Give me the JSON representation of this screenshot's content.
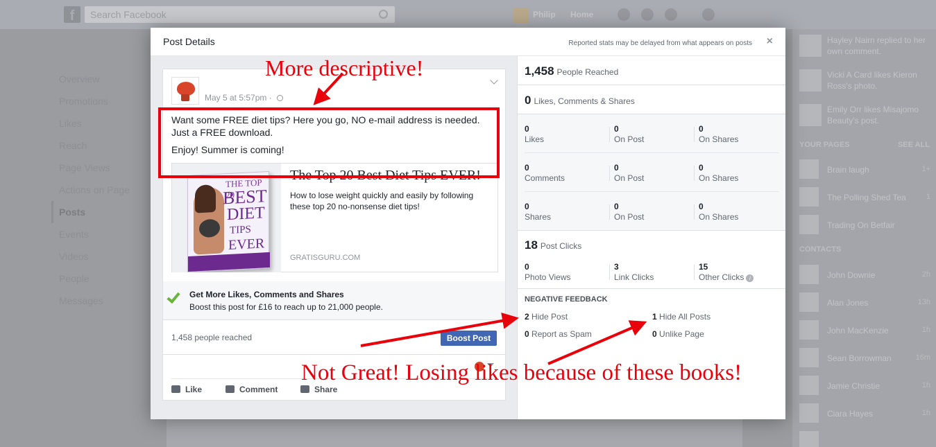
{
  "background": {
    "search_placeholder": "Search Facebook",
    "user_name": "Philip",
    "home_label": "Home",
    "nav_items": [
      "Overview",
      "Promotions",
      "Likes",
      "Reach",
      "Page Views",
      "Actions on Page",
      "Posts",
      "Events",
      "Videos",
      "People",
      "Messages"
    ],
    "active_nav": "Posts",
    "notifications": [
      "Hayley Nairn replied to her own comment.",
      "Vicki A Card likes Kieron Ross's photo.",
      "Emily Orr likes Misajomo Beauty's post."
    ],
    "your_pages_label": "YOUR PAGES",
    "see_all_label": "SEE ALL",
    "pages": [
      {
        "name": "Brain laugh",
        "count": "1+"
      },
      {
        "name": "The Polling Shed Tea",
        "count": "1"
      },
      {
        "name": "Trading On Betfair",
        "count": ""
      }
    ],
    "contacts_label": "CONTACTS",
    "contacts": [
      {
        "name": "John Downie",
        "time": "2h"
      },
      {
        "name": "Alan Jones",
        "time": "13h"
      },
      {
        "name": "John MacKenzie",
        "time": "1h"
      },
      {
        "name": "Sean Borrowman",
        "time": "16m"
      },
      {
        "name": "Jamie Christie",
        "time": "1h"
      },
      {
        "name": "Ciara Hayes",
        "time": "1h"
      },
      {
        "name": "",
        "time": ""
      }
    ]
  },
  "modal": {
    "title": "Post Details",
    "note": "Reported stats may be delayed from what appears on posts",
    "close_label": "×"
  },
  "post": {
    "timestamp": "May 5 at 5:57pm",
    "text_line1": "Want some FREE diet tips? Here you go, NO e-mail address is needed. Just a FREE download.",
    "text_line2": "Enjoy! Summer is coming!",
    "link": {
      "title": "The Top 20 Best Diet Tips EVER!",
      "description": "How to lose weight quickly and easily by following these top 20 no-nonsense diet tips!",
      "domain": "GRATISGURU.COM",
      "book_lines": [
        "THE TOP 20",
        "BEST",
        "DIET",
        "TIPS",
        "EVER"
      ]
    },
    "boost_title": "Get More Likes, Comments and Shares",
    "boost_sub": "Boost this post for £16 to reach up to 21,000 people.",
    "reached": "1,458 people reached",
    "boost_button": "Boost Post",
    "actions": {
      "like": "Like",
      "comment": "Comment",
      "share": "Share"
    }
  },
  "stats": {
    "people_reached": {
      "value": "1,458",
      "label": "People Reached"
    },
    "engagement": {
      "value": "0",
      "label": "Likes, Comments & Shares"
    },
    "grid": [
      [
        {
          "n": "0",
          "l": "Likes"
        },
        {
          "n": "0",
          "l": "On Post"
        },
        {
          "n": "0",
          "l": "On Shares"
        }
      ],
      [
        {
          "n": "0",
          "l": "Comments"
        },
        {
          "n": "0",
          "l": "On Post"
        },
        {
          "n": "0",
          "l": "On Shares"
        }
      ],
      [
        {
          "n": "0",
          "l": "Shares"
        },
        {
          "n": "0",
          "l": "On Post"
        },
        {
          "n": "0",
          "l": "On Shares"
        }
      ]
    ],
    "post_clicks": {
      "value": "18",
      "label": "Post Clicks"
    },
    "clicks": [
      {
        "n": "0",
        "l": "Photo Views"
      },
      {
        "n": "3",
        "l": "Link Clicks"
      },
      {
        "n": "15",
        "l": "Other Clicks"
      }
    ],
    "negative_feedback_label": "NEGATIVE FEEDBACK",
    "negative": {
      "hide_post": {
        "n": "2",
        "l": "Hide Post"
      },
      "hide_all": {
        "n": "1",
        "l": "Hide All Posts"
      },
      "spam": {
        "n": "0",
        "l": "Report as Spam"
      },
      "unlike": {
        "n": "0",
        "l": "Unlike Page"
      }
    }
  },
  "annotations": {
    "top": "More descriptive!",
    "bottom": "Not Great! Losing likes because of these books!",
    "color": "#e8000a"
  }
}
